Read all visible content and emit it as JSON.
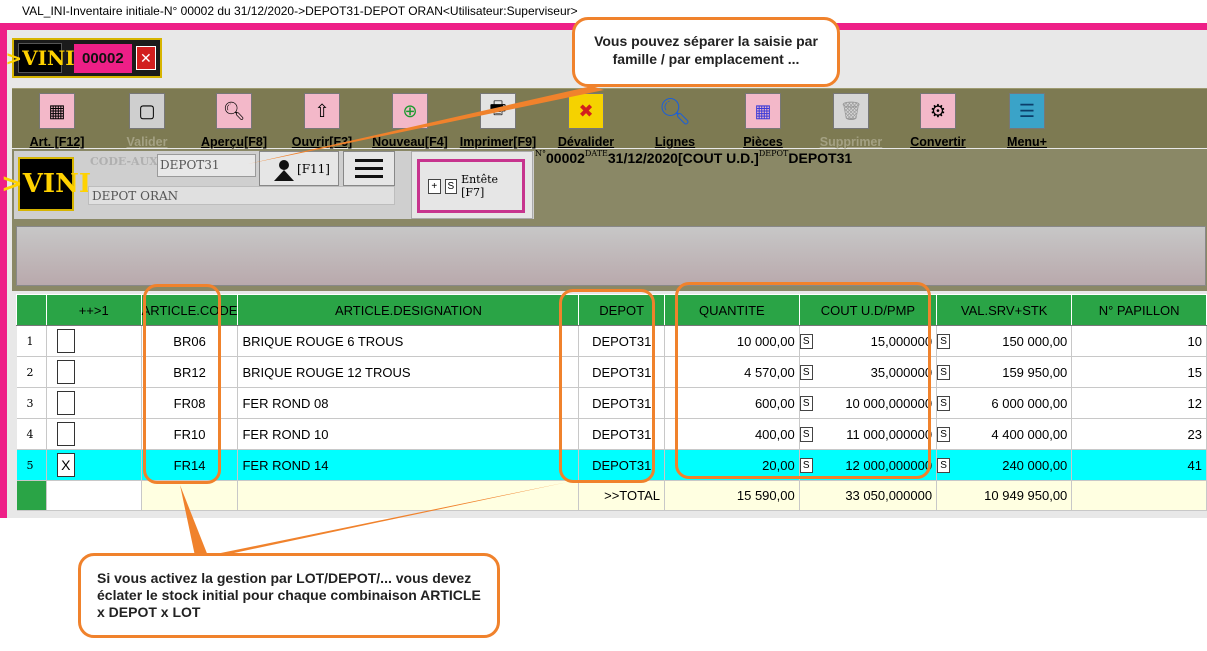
{
  "window": {
    "title": "VAL_INI-Inventaire initiale-N° 00002 du 31/12/2020->DEPOT31-DEPOT ORAN<Utilisateur:Superviseur>"
  },
  "badge": {
    "logo": ">VINI",
    "number": "00002",
    "close_icon": "close-x-icon"
  },
  "toolbar": {
    "items": [
      {
        "label": "Art. [F12]",
        "icon": "article-grid-icon",
        "enabled": true
      },
      {
        "label": "Valider",
        "icon": "validate-icon",
        "enabled": false
      },
      {
        "label": "Aperçu[F8]",
        "icon": "preview-magnifier-icon",
        "enabled": true
      },
      {
        "label": "Ouvrir[F3]",
        "icon": "open-arrow-icon",
        "enabled": true
      },
      {
        "label": "Nouveau[F4]",
        "icon": "new-plus-icon",
        "enabled": true
      },
      {
        "label": "Imprimer[F9]",
        "icon": "printer-icon",
        "enabled": true
      },
      {
        "label": "Dévalider",
        "icon": "unvalidate-x-icon",
        "enabled": true
      },
      {
        "label": "Lignes",
        "icon": "lines-magnifier-icon",
        "enabled": true
      },
      {
        "label": "Pièces",
        "icon": "pieces-grid-icon",
        "enabled": true
      },
      {
        "label": "Supprimer",
        "icon": "delete-icon",
        "enabled": false
      },
      {
        "label": "Convertir",
        "icon": "convert-gear-icon",
        "enabled": true
      },
      {
        "label": "Menu+",
        "icon": "menu-lines-icon",
        "enabled": true
      }
    ]
  },
  "form": {
    "logo": ">VINI",
    "code_aux_label": "CODE-AUX",
    "code_aux_value": "DEPOT31",
    "f11_label": "[F11]",
    "depot_name": "DEPOT ORAN",
    "entete_plus": "+",
    "entete_s": "S",
    "entete_label": "Entête [F7]"
  },
  "header_summary": {
    "num_label": "N°",
    "num": "00002",
    "date_label": "DATE",
    "date": "31/12/2020",
    "cost_mode": "[COUT U.D.]",
    "depot_label": "DEPOT",
    "depot": "DEPOT31"
  },
  "grid": {
    "columns": [
      "",
      "++>1",
      "ARTICLE.CODE",
      "ARTICLE.DESIGNATION",
      "DEPOT",
      "QUANTITE",
      "COUT U.D/PMP",
      "VAL.SRV+STK",
      "N° PAPILLON"
    ],
    "rows": [
      {
        "n": "1",
        "checked": "",
        "code": "BR06",
        "designation": "BRIQUE ROUGE 6 TROUS",
        "depot": "DEPOT31",
        "quantite": "10 000,00",
        "cout": "15,000000",
        "val": "150 000,00",
        "papillon": "10"
      },
      {
        "n": "2",
        "checked": "",
        "code": "BR12",
        "designation": "BRIQUE ROUGE 12 TROUS",
        "depot": "DEPOT31",
        "quantite": "4 570,00",
        "cout": "35,000000",
        "val": "159 950,00",
        "papillon": "15"
      },
      {
        "n": "3",
        "checked": "",
        "code": "FR08",
        "designation": "FER ROND 08",
        "depot": "DEPOT31",
        "quantite": "600,00",
        "cout": "10 000,000000",
        "val": "6 000 000,00",
        "papillon": "12"
      },
      {
        "n": "4",
        "checked": "",
        "code": "FR10",
        "designation": "FER ROND 10",
        "depot": "DEPOT31",
        "quantite": "400,00",
        "cout": "11 000,000000",
        "val": "4 400 000,00",
        "papillon": "23"
      },
      {
        "n": "5",
        "checked": "X",
        "code": "FR14",
        "designation": "FER ROND 14",
        "depot": "DEPOT31",
        "quantite": "20,00",
        "cout": "12 000,000000",
        "val": "240 000,00",
        "papillon": "41"
      }
    ],
    "s_marker": "S",
    "total": {
      "label": ">>TOTAL",
      "quantite": "15 590,00",
      "cout": "33 050,000000",
      "val": "10 949 950,00"
    }
  },
  "callouts": {
    "top": "Vous pouvez séparer la saisie par famille / par emplacement ...",
    "bottom": "Si vous activez la gestion par LOT/DEPOT/... vous devez éclater le stock initial pour chaque combinaison ARTICLE x DEPOT x LOT"
  }
}
